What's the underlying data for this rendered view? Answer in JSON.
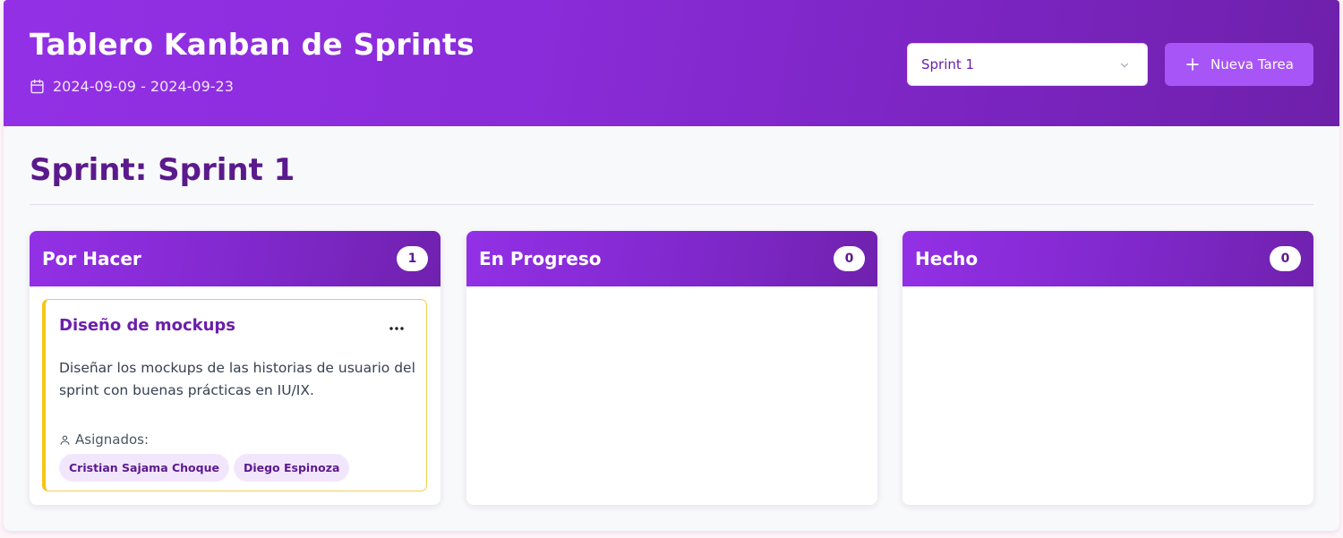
{
  "header": {
    "title": "Tablero Kanban de Sprints",
    "date_range": "2024-09-09 - 2024-09-23",
    "sprint_select": {
      "selected": "Sprint 1"
    },
    "new_task_label": "Nueva Tarea"
  },
  "main": {
    "sprint_heading": "Sprint: Sprint 1",
    "columns": [
      {
        "title": "Por Hacer",
        "count": "1",
        "tasks": [
          {
            "title": "Diseño de mockups",
            "menu": "...",
            "description": "Diseñar los mockups de las historias de usuario del sprint con buenas prácticas en IU/IX.",
            "assigned_label": "Asignados:",
            "assignees": [
              "Cristian Sajama Choque",
              "Diego Espinoza"
            ]
          }
        ]
      },
      {
        "title": "En Progreso",
        "count": "0",
        "tasks": []
      },
      {
        "title": "Hecho",
        "count": "0",
        "tasks": []
      }
    ]
  },
  "colors": {
    "accent": "#9330e6",
    "accent_dark": "#6e20aa",
    "button": "#a855f7",
    "priority_border": "#f5c518",
    "chip_bg": "#f2e6fd"
  },
  "icons": {
    "date": "calendar-icon",
    "select": "chevron-down-icon",
    "new_task": "plus-icon",
    "task_menu": "more-horizontal-icon",
    "assigned": "user-icon"
  }
}
